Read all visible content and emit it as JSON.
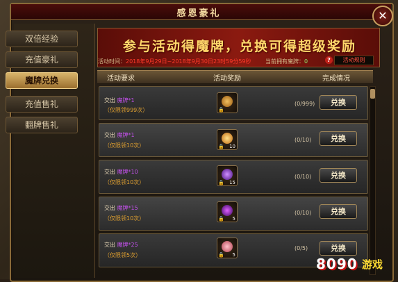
{
  "window": {
    "title": "感恩豪礼",
    "close_icon": "close-icon"
  },
  "sidebar": {
    "items": [
      {
        "label": "双倍经验",
        "active": false
      },
      {
        "label": "充值豪礼",
        "active": false
      },
      {
        "label": "魔牌兑换",
        "active": true
      },
      {
        "label": "充值售礼",
        "active": false
      },
      {
        "label": "翻牌售礼",
        "active": false
      }
    ]
  },
  "banner": {
    "headline": "参与活动得魔牌，兑换可得超级奖励",
    "time_label": "活动时间：",
    "time_value": "2018年9月29日~2018年9月30日23时59分59秒",
    "medal_label": "当前拥有魔牌：",
    "medal_count": "0",
    "rules_label": "活动规则"
  },
  "table": {
    "headers": [
      "活动要求",
      "活动奖励",
      "完成情况"
    ],
    "rows": [
      {
        "exchange": "交出",
        "medal": "魔牌",
        "amount": "*1",
        "limit": "（仅限领999次）",
        "reward_icon": "gold-pouch-icon",
        "reward_count": "",
        "progress": "(0/999)",
        "button": "兑换"
      },
      {
        "exchange": "交出",
        "medal": "魔牌",
        "amount": "*1",
        "limit": "（仅限领10次）",
        "reward_icon": "feather-icon",
        "reward_count": "10",
        "progress": "(0/10)",
        "button": "兑换"
      },
      {
        "exchange": "交出",
        "medal": "魔牌",
        "amount": "*10",
        "limit": "（仅限领10次）",
        "reward_icon": "purple-gem-icon",
        "reward_count": "15",
        "progress": "(0/10)",
        "button": "兑换"
      },
      {
        "exchange": "交出",
        "medal": "魔牌",
        "amount": "*15",
        "limit": "（仅限领10次）",
        "reward_icon": "purple-orb-icon",
        "reward_count": "5",
        "progress": "(0/10)",
        "button": "兑换"
      },
      {
        "exchange": "交出",
        "medal": "魔牌",
        "amount": "*25",
        "limit": "（仅限领5次）",
        "reward_icon": "pink-flower-icon",
        "reward_count": "5",
        "progress": "(0/5)",
        "button": "兑换"
      }
    ]
  },
  "watermark": {
    "brand": "8090",
    "suffix": "游戏"
  },
  "colors": {
    "accent": "#ffd76a",
    "banner_red": "#8b1a10",
    "medal_purple": "#c050e8",
    "limit_orange": "#e0a030"
  }
}
